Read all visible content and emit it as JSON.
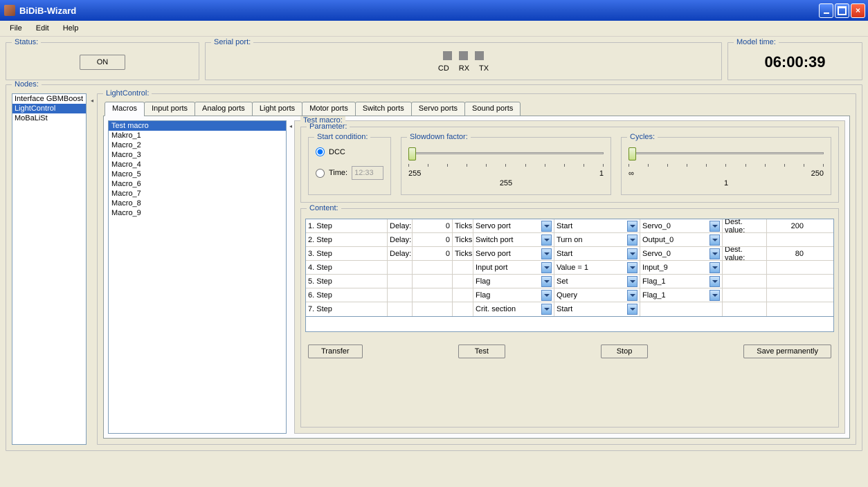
{
  "title": "BiDiB-Wizard",
  "menubar": [
    "File",
    "Edit",
    "Help"
  ],
  "status": {
    "legend": "Status:",
    "button": "ON"
  },
  "serial": {
    "legend": "Serial port:",
    "labels": [
      "CD",
      "RX",
      "TX"
    ]
  },
  "model": {
    "legend": "Model time:",
    "time": "06:00:39"
  },
  "nodes": {
    "legend": "Nodes:",
    "items": [
      "Interface GBMBoost",
      "LightControl",
      "MoBaLiSt"
    ],
    "selected": 1
  },
  "panel": {
    "legend": "LightControl:",
    "tabs": [
      "Macros",
      "Input ports",
      "Analog ports",
      "Light ports",
      "Motor ports",
      "Switch ports",
      "Servo ports",
      "Sound ports"
    ],
    "activeTab": 0
  },
  "macros": {
    "items": [
      "Test macro",
      "Makro_1",
      "Macro_2",
      "Macro_3",
      "Macro_4",
      "Macro_5",
      "Macro_6",
      "Macro_7",
      "Macro_8",
      "Macro_9"
    ],
    "selected": 0
  },
  "detail": {
    "legend": "Test macro:",
    "param_legend": "Parameter:",
    "start": {
      "legend": "Start condition:",
      "dcc": "DCC",
      "time": "Time:",
      "time_value": "12:33"
    },
    "slowdown": {
      "legend": "Slowdown factor:",
      "min": "255",
      "max": "1",
      "center": "255"
    },
    "cycles": {
      "legend": "Cycles:",
      "min": "∞",
      "max": "250",
      "center": "1"
    },
    "content_legend": "Content:",
    "labels": {
      "delay": "Delay:",
      "ticks": "Ticks",
      "dest": "Dest. value:"
    },
    "rows": [
      {
        "step": "1. Step",
        "delay": "0",
        "type": "Servo port",
        "action": "Start",
        "target": "Servo_0",
        "dest": "200"
      },
      {
        "step": "2. Step",
        "delay": "0",
        "type": "Switch port",
        "action": "Turn on",
        "target": "Output_0",
        "dest": ""
      },
      {
        "step": "3. Step",
        "delay": "0",
        "type": "Servo port",
        "action": "Start",
        "target": "Servo_0",
        "dest": "80"
      },
      {
        "step": "4. Step",
        "delay": "",
        "type": "Input port",
        "action": "Value = 1",
        "target": "Input_9",
        "dest": ""
      },
      {
        "step": "5. Step",
        "delay": "",
        "type": "Flag",
        "action": "Set",
        "target": "Flag_1",
        "dest": ""
      },
      {
        "step": "6. Step",
        "delay": "",
        "type": "Flag",
        "action": "Query",
        "target": "Flag_1",
        "dest": ""
      },
      {
        "step": "7. Step",
        "delay": "",
        "type": "Crit. section",
        "action": "Start",
        "target": "",
        "dest": ""
      }
    ],
    "buttons": {
      "transfer": "Transfer",
      "test": "Test",
      "stop": "Stop",
      "save": "Save permanently"
    }
  }
}
